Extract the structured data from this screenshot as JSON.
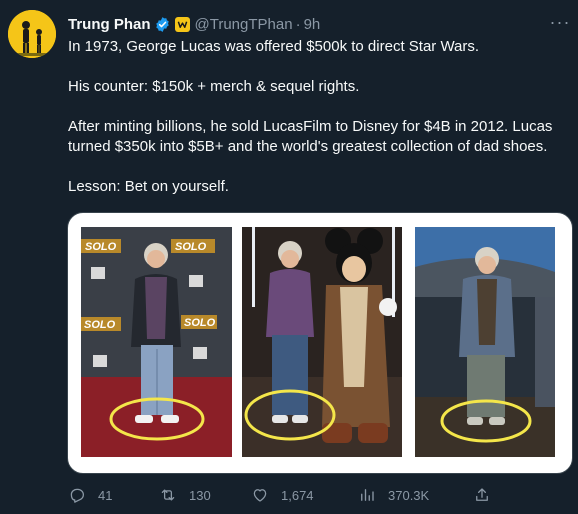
{
  "author": {
    "name": "Trung Phan",
    "handle": "@TrungTPhan",
    "time": "9h"
  },
  "tweet": {
    "paragraphs": [
      "In 1973, George Lucas was offered $500k to direct Star Wars.",
      "His counter: $150k + merch & sequel rights.",
      "After minting billions, he sold LucasFilm to Disney for $4B in 2012. Lucas turned $350k into $5B+ and the world's greatest collection of dad shoes.",
      "Lesson: Bet on yourself."
    ]
  },
  "media": {
    "photo1_signs": [
      "SOLO",
      "SOLO",
      "SOLO",
      "SOLO"
    ]
  },
  "actions": {
    "replies": "41",
    "retweets": "130",
    "likes": "1,674",
    "views": "370.3K"
  },
  "colors": {
    "background": "#15202b",
    "text": "#f7f9f9",
    "muted": "#8b98a5",
    "verified": "#1d9bf0",
    "highlight": "#f4e64a"
  },
  "icons": [
    "verified-badge-icon",
    "affiliate-badge-icon",
    "more-icon",
    "reply-icon",
    "retweet-icon",
    "like-icon",
    "views-icon",
    "share-icon"
  ]
}
